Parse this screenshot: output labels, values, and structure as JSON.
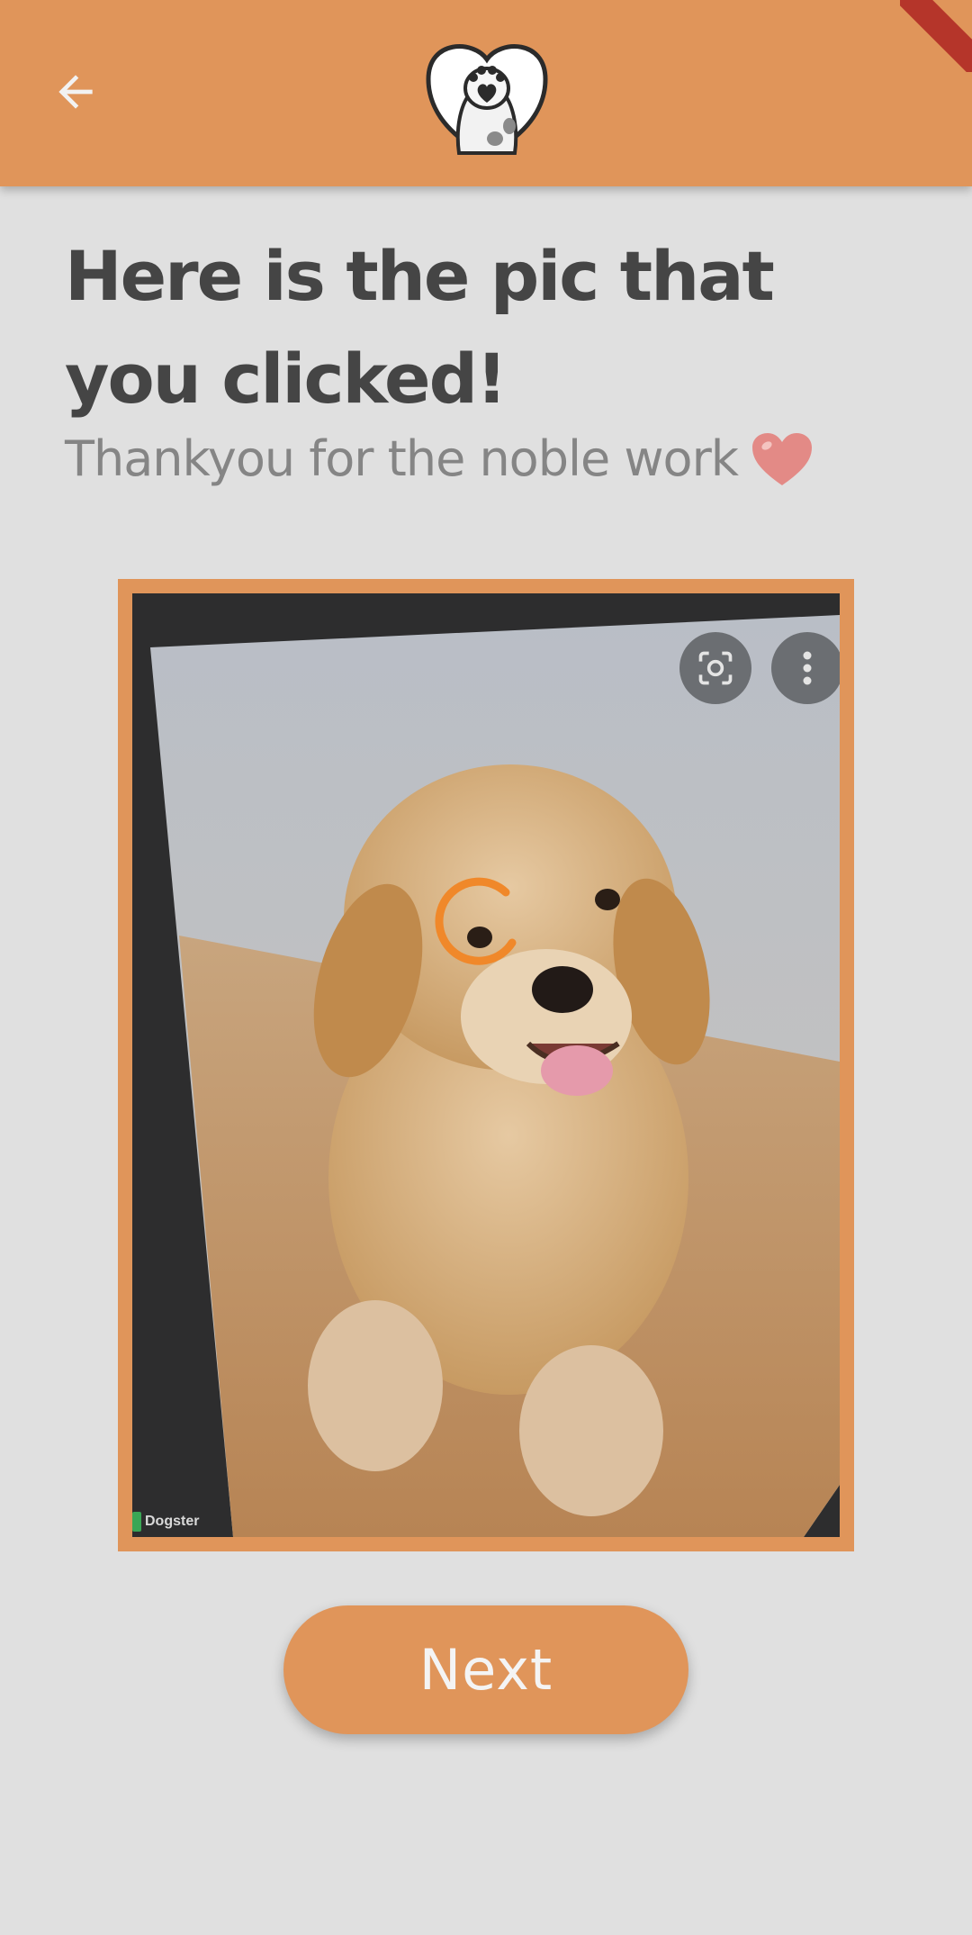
{
  "app_bar": {
    "back_icon": "arrow-left-icon",
    "logo_icon": "heart-paw-logo-icon",
    "color": "#e0955a"
  },
  "content": {
    "title": "Here is the pic that you clicked!",
    "subtitle": "Thankyou for the noble work",
    "subtitle_icon": "heart-emoji-icon"
  },
  "photo": {
    "watermark": "Dogster",
    "overlay_icons": [
      "lens-scan-icon",
      "more-vert-icon"
    ],
    "loading_indicator": "loading-spinner-icon"
  },
  "next_button": {
    "label": "Next"
  }
}
